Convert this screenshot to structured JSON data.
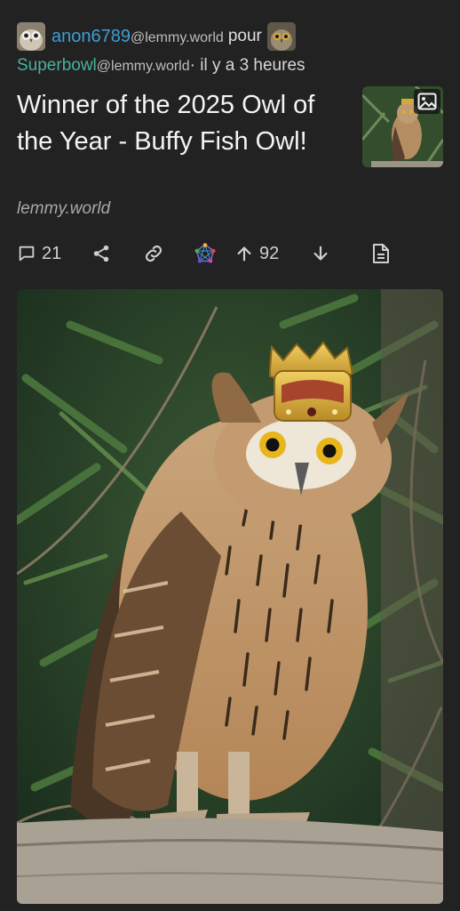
{
  "post": {
    "author": "anon6789",
    "author_instance": "@lemmy.world",
    "connector": "pour",
    "community": "Superbowl",
    "community_instance": "@lemmy.world",
    "time": " · il y a 3 heures",
    "title": "Winner of the 2025 Owl of the Year - Buffy Fish Owl!",
    "domain": "lemmy.world"
  },
  "actions": {
    "comments_count": "21",
    "score": "92"
  },
  "icons": {
    "comments": "comment-icon",
    "share": "share-icon",
    "link": "link-icon",
    "crosspost": "fediverse-icon",
    "upvote": "arrow-up-icon",
    "downvote": "arrow-down-icon",
    "details": "document-icon",
    "thumbnail_badge": "image-icon"
  },
  "colors": {
    "background": "#222222",
    "username": "#3d9fd6",
    "community": "#46b39c"
  }
}
